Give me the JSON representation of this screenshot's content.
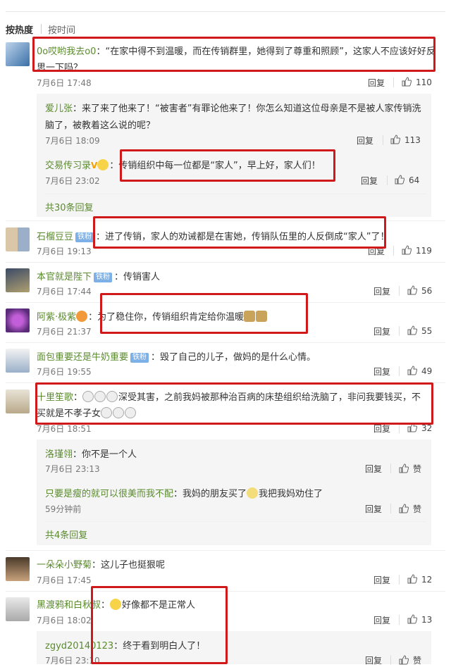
{
  "tabs": {
    "hot": "按热度",
    "time": "按时间"
  },
  "ui": {
    "reply": "回复"
  },
  "comments": [
    {
      "name": "0o哎哟我去o0",
      "text": "：“在家中得不到温暖，而在传销群里，她得到了尊重和照顾”，这家人不应该好好反",
      "text2": "思一下吗？",
      "time": "7月6日 17:48",
      "likes": "110",
      "subs": [
        {
          "name": "爱儿张",
          "text": "：来了来了他来了！“被害者”有罪论他来了！你怎么知道这位母亲是不是被人家传销洗",
          "text2": "脑了，被教着这么说的呢？",
          "time": "7月6日 18:09",
          "likes": "113"
        },
        {
          "name": "交易传习录",
          "text": "：传销组织中每一位都是“家人”，早上好，家人们！",
          "time": "7月6日 23:02",
          "likes": "64"
        }
      ],
      "more": "共30条回复"
    },
    {
      "name": "石榴豆豆",
      "badge": "铁粉",
      "text": "：进了传销，家人的劝诫都是在害她，传销队伍里的人反倒成“家人”了！",
      "time": "7月6日 19:13",
      "likes": "119"
    },
    {
      "name": "本官就是陛下",
      "badge": "铁粉",
      "text": "：传销害人",
      "time": "7月6日 17:44",
      "likes": "56"
    },
    {
      "name": "阿紫·极紫",
      "text": "：为了稳住你，传销组织肯定给你温暖",
      "time": "7月6日 21:37",
      "likes": "55"
    },
    {
      "name": "面包重要还是牛奶重要",
      "badge": "铁粉",
      "text": "：毁了自己的儿子，做妈的是什么心情。",
      "time": "7月6日 19:55",
      "likes": "49"
    },
    {
      "name": "十里笙歌",
      "text": "：",
      "text_after": "深受其害，之前我妈被那种治百病的床垫组织给洗脑了，非问我要钱买，不",
      "text2": "买就是不孝子女",
      "time": "7月6日 18:51",
      "likes": "32",
      "subs": [
        {
          "name": "洛瑾翎",
          "text": "：你不是一个人",
          "time": "7月6日 23:13",
          "likes": "赞"
        },
        {
          "name": "只要是瘦的就可以很美而我不配",
          "text": "：我妈的朋友买了",
          "text_after": "我把我妈劝住了",
          "time": "59分钟前",
          "likes": "赞"
        }
      ],
      "more": "共4条回复"
    },
    {
      "name": "一朵朵小野菊",
      "text": "：这儿子也挺狠呢",
      "time": "7月6日 17:45",
      "likes": "12"
    },
    {
      "name": "黑渡鸦和白秋叔",
      "text": "：",
      "text_after": "好像都不是正常人",
      "time": "7月6日 18:02",
      "likes": "13",
      "subs": [
        {
          "name": "zgyd20140123",
          "text": "：终于看到明白人了！",
          "time": "7月6日 23:10",
          "likes": "赞"
        }
      ]
    }
  ],
  "colors": {
    "name": "#5a8a2e",
    "highlight": "#d0191a",
    "badge": "#7cb0e6"
  }
}
